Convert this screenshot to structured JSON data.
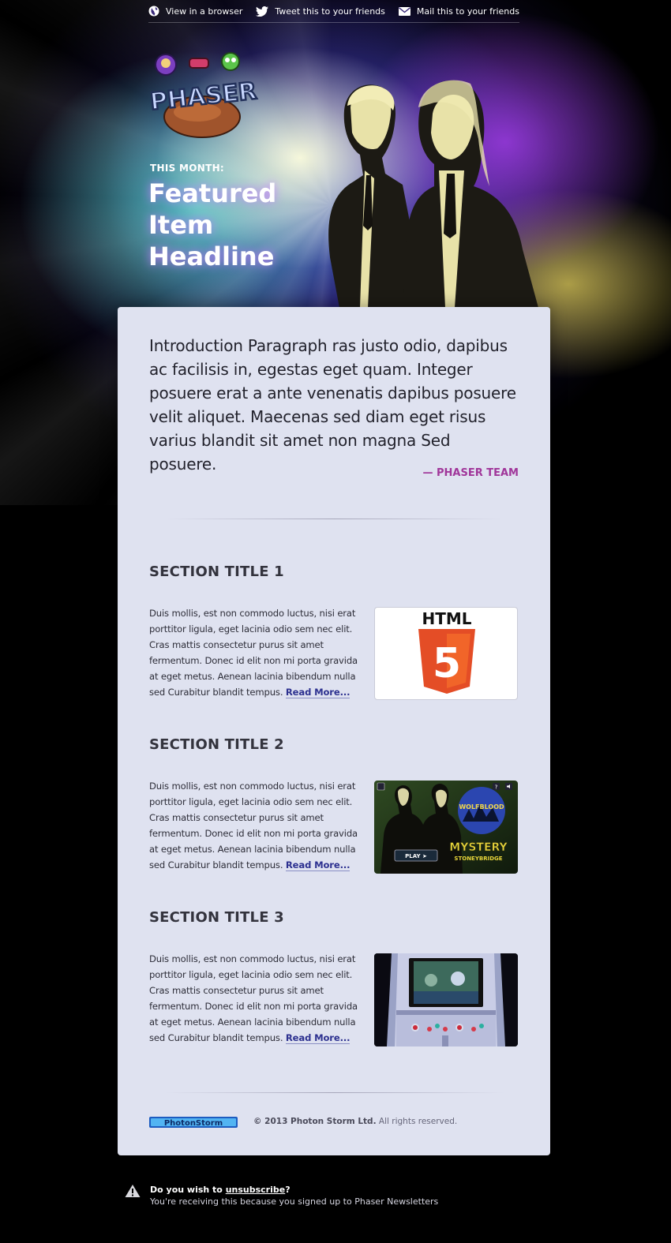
{
  "topbar": {
    "view_browser": "View in a browser",
    "tweet": "Tweet this to your friends",
    "mail": "Mail this to your friends"
  },
  "logo": {
    "text": "PHASER"
  },
  "hero": {
    "kicker": "THIS MONTH:",
    "headline": "Featured Item Headline"
  },
  "intro": {
    "paragraph": "Introduction Paragraph ras justo odio, dapibus ac facilisis in, egestas eget quam. Integer posuere erat a ante venenatis dapibus posuere velit aliquet. Maecenas sed diam eget risus varius blandit sit amet non magna Sed posuere.",
    "signature": "— PHASER TEAM"
  },
  "sections": [
    {
      "title": "SECTION TITLE 1",
      "body": "Duis mollis, est non commodo luctus, nisi erat porttitor ligula, eget lacinia odio sem nec elit. Cras mattis consectetur purus sit amet fermentum. Donec id elit non mi porta gravida at eget metus. Aenean lacinia bibendum nulla sed Curabitur blandit tempus.",
      "link": "Read More...",
      "image_label": "HTML",
      "image_badge": "5"
    },
    {
      "title": "SECTION TITLE 2",
      "body": "Duis mollis, est non commodo luctus, nisi erat porttitor ligula, eget lacinia odio sem nec elit. Cras mattis consectetur purus sit amet fermentum. Donec id elit non mi porta gravida at eget metus. Aenean lacinia bibendum nulla sed Curabitur blandit tempus.",
      "link": "Read More...",
      "image_wolf": "WOLFBLOOD",
      "image_mystery": "MYSTERY",
      "image_place": "STONEYBRIDGE",
      "image_play": "PLAY ➤"
    },
    {
      "title": "SECTION TITLE 3",
      "body": "Duis mollis, est non commodo luctus, nisi erat porttitor ligula, eget lacinia odio sem nec elit. Cras mattis consectetur purus sit amet fermentum. Donec id elit non mi porta gravida at eget metus. Aenean lacinia bibendum nulla sed Curabitur blandit tempus.",
      "link": "Read More..."
    }
  ],
  "footer": {
    "logo_text": "PhotonStorm",
    "company": "© 2013 Photon Storm Ltd.",
    "rights": "All rights reserved."
  },
  "unsubscribe": {
    "question_prefix": "Do you wish to ",
    "link": "unsubscribe",
    "question_suffix": "?",
    "reason": "You're receiving this because you signed up to Phaser Newsletters"
  },
  "colors": {
    "card_bg": "#dfe2f0",
    "signature": "#a0369a",
    "link": "#2d3190",
    "html5_orange": "#e44d26"
  }
}
